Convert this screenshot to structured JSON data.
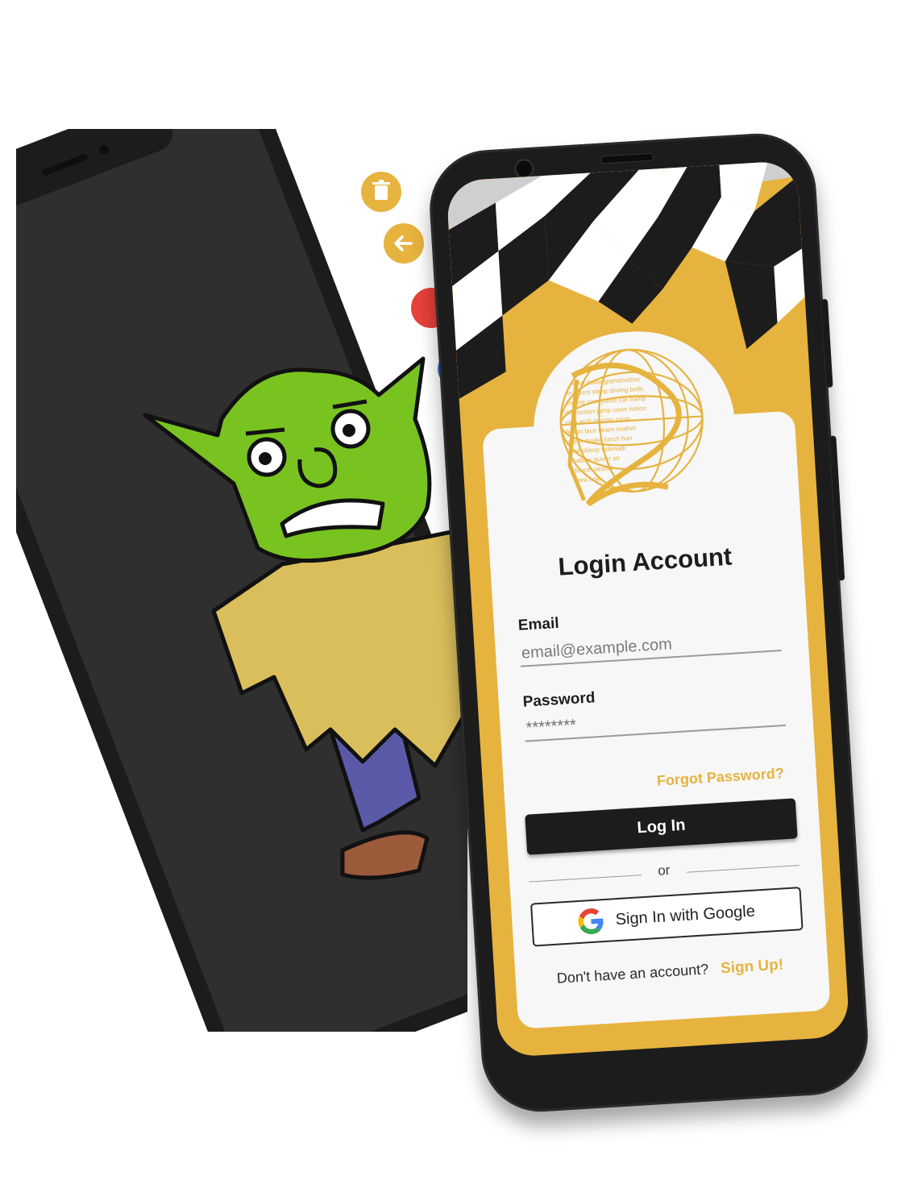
{
  "back_phone": {
    "toolbar": {
      "delete_icon": "trash-icon",
      "back_icon": "arrow-left-icon"
    },
    "palette": [
      {
        "color": "#e8403a"
      },
      {
        "color": "#3a72e6"
      }
    ],
    "drawing": {
      "subject": "green-goblin"
    }
  },
  "login": {
    "title": "Login Account",
    "email": {
      "label": "Email",
      "placeholder": "email@example.com"
    },
    "password": {
      "label": "Password",
      "value": "********"
    },
    "forgot_label": "Forgot Password?",
    "login_button": "Log In",
    "divider_text": "or",
    "google_button": "Sign In with Google",
    "signup_prompt": "Don't have an account?",
    "signup_link": "Sign Up!"
  },
  "colors": {
    "accent": "#e6b33f",
    "dark": "#1c1c1c",
    "card": "#f7f7f7"
  }
}
